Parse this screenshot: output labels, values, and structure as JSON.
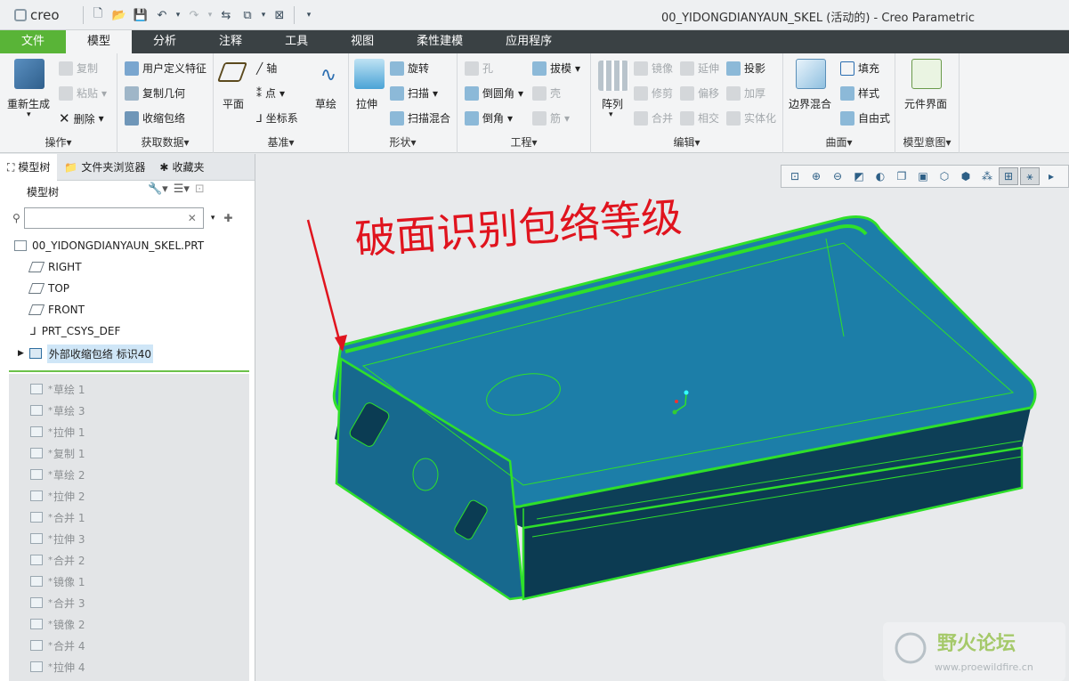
{
  "app": {
    "logo": "creo",
    "window_title": "00_YIDONGDIANYAUN_SKEL (活动的) - Creo Parametric"
  },
  "ribbon_tabs": [
    "文件",
    "模型",
    "分析",
    "注释",
    "工具",
    "视图",
    "柔性建模",
    "应用程序"
  ],
  "ribbon": {
    "operations": {
      "label": "操作",
      "regenerate": "重新生成",
      "copy": "复制",
      "paste": "粘贴",
      "delete": "删除"
    },
    "get_data": {
      "label": "获取数据",
      "udf": "用户定义特征",
      "copy_geom": "复制几何",
      "shrinkwrap": "收缩包络"
    },
    "datum": {
      "label": "基准",
      "plane": "平面",
      "axis": "轴",
      "point": "点",
      "csys": "坐标系",
      "sketch": "草绘"
    },
    "shapes": {
      "label": "形状",
      "extrude": "拉伸",
      "revolve": "旋转",
      "sweep": "扫描",
      "swept_blend": "扫描混合"
    },
    "engineering": {
      "label": "工程",
      "hole": "孔",
      "round": "倒圆角",
      "chamfer": "倒角",
      "draft": "拔模",
      "shell": "壳",
      "rib": "筋"
    },
    "editing": {
      "label": "编辑",
      "pattern": "阵列",
      "mirror": "镜像",
      "trim": "修剪",
      "merge": "合并",
      "extend": "延伸",
      "offset": "偏移",
      "intersect": "相交",
      "project": "投影",
      "thicken": "加厚",
      "solidify": "实体化"
    },
    "surfaces": {
      "label": "曲面",
      "boundary_blend": "边界混合",
      "fill": "填充",
      "style": "样式",
      "freestyle": "自由式"
    },
    "model_intent": {
      "label": "模型意图",
      "component_interface": "元件界面"
    }
  },
  "panel_tabs": [
    "模型树",
    "文件夹浏览器",
    "收藏夹"
  ],
  "tree": {
    "header": "模型树",
    "filter_placeholder": "",
    "root": "00_YIDONGDIANYAUN_SKEL.PRT",
    "datums": [
      "RIGHT",
      "TOP",
      "FRONT",
      "PRT_CSYS_DEF"
    ],
    "selected": "外部收缩包络 标识40",
    "suppressed": [
      "草绘 1",
      "草绘 3",
      "拉伸 1",
      "复制 1",
      "草绘 2",
      "拉伸 2",
      "合并 1",
      "拉伸 3",
      "合并 2",
      "镜像 1",
      "合并 3",
      "镜像 2",
      "合并 4",
      "拉伸 4"
    ]
  },
  "annotation": {
    "handwritten_text": "破面识别包络等级",
    "color": "#e0141e"
  },
  "watermark": {
    "site_name": "野火论坛",
    "url": "www.proewildfire.cn"
  },
  "colors": {
    "file_tab": "#59b437",
    "tab_bar": "#3a4144",
    "model_fill": "#1f7fa6",
    "model_edges": "#2fe02a"
  }
}
